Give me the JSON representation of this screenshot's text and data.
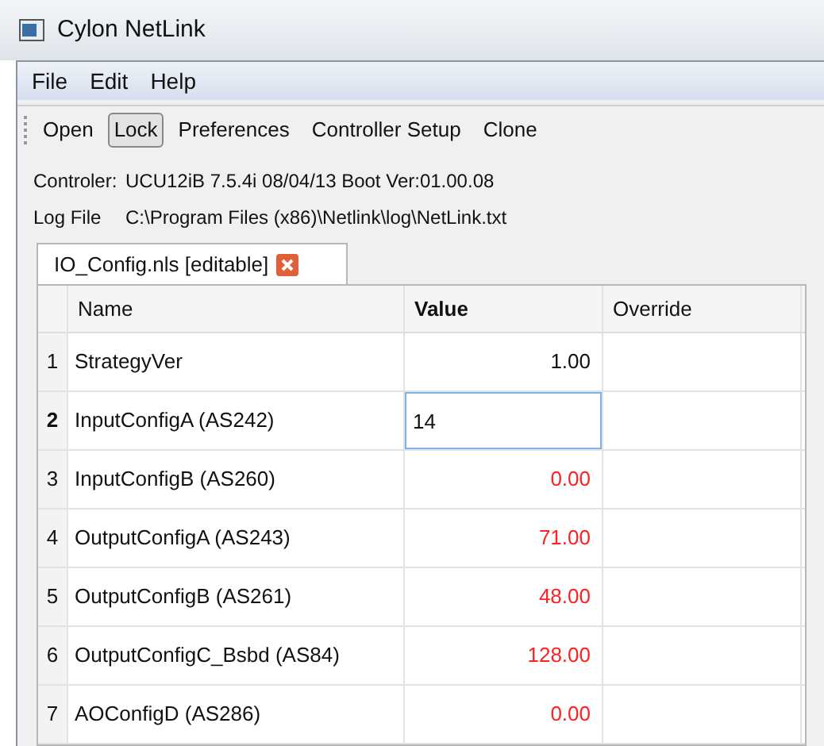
{
  "window": {
    "title": "Cylon NetLink"
  },
  "menu": [
    "File",
    "Edit",
    "Help"
  ],
  "toolbar": [
    {
      "label": "Open",
      "pressed": false
    },
    {
      "label": "Lock",
      "pressed": true
    },
    {
      "label": "Preferences",
      "pressed": false
    },
    {
      "label": "Controller Setup",
      "pressed": false
    },
    {
      "label": "Clone",
      "pressed": false
    }
  ],
  "info": [
    {
      "label": "Controler:",
      "value": "UCU12iB 7.5.4i 08/04/13 Boot Ver:01.00.08"
    },
    {
      "label": "Log File",
      "value": "C:\\Program Files (x86)\\Netlink\\log\\NetLink.txt"
    }
  ],
  "tabs": [
    {
      "label": "IO_Config.nls [editable]",
      "selected": true
    }
  ],
  "table": {
    "columns": [
      {
        "label": "Name",
        "selected": false
      },
      {
        "label": "Value",
        "selected": true
      },
      {
        "label": "Override",
        "selected": false
      }
    ],
    "rows": [
      {
        "number": "1",
        "name": "StrategyVer",
        "value": "1.00",
        "selected": false,
        "changed": false
      },
      {
        "number": "2",
        "name": "InputConfigA (AS242)",
        "value": "14",
        "selected": true
      },
      {
        "number": "3",
        "name": "InputConfigB (AS260)",
        "value": "0.00",
        "selected": false,
        "changed": true
      },
      {
        "number": "4",
        "name": "OutputConfigA (AS243)",
        "value": "71.00",
        "selected": false,
        "changed": true
      },
      {
        "number": "5",
        "name": "OutputConfigB (AS261)",
        "value": "48.00",
        "selected": false,
        "changed": true
      },
      {
        "number": "6",
        "name": "OutputConfigC_Bsbd (AS84)",
        "value": "128.00",
        "selected": false,
        "changed": true
      },
      {
        "number": "7",
        "name": "AOConfigD (AS286)",
        "value": "0.00",
        "selected": false,
        "changed": true
      }
    ]
  }
}
